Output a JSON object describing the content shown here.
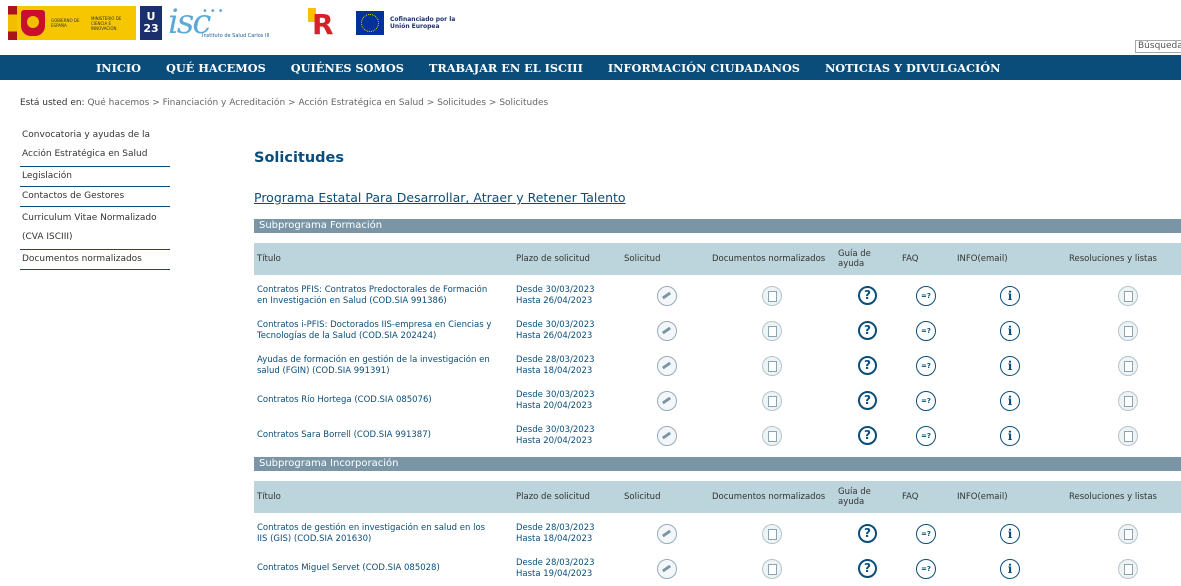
{
  "header": {
    "gov_text": [
      "GOBIERNO DE ESPAÑA",
      "MINISTERIO DE CIENCIA E INNOVACIÓN"
    ],
    "ue_text": [
      "U",
      "23"
    ],
    "isciii_logo": "isc",
    "isciii_sub": "Instituto de Salud Carlos III",
    "tr_logo": "R",
    "cofinanciado": "Cofinanciado por la Unión Europea",
    "search_placeholder": "Búsqueda..."
  },
  "nav": [
    "INICIO",
    "QUÉ HACEMOS",
    "QUIÉNES SOMOS",
    "TRABAJAR EN EL ISCIII",
    "INFORMACIÓN CIUDADANOS",
    "NOTICIAS Y DIVULGACIÓN"
  ],
  "breadcrumb": {
    "label": "Está usted en:",
    "items": [
      "Qué hacemos",
      "Financiación y Acreditación",
      "Acción Estratégica en Salud",
      "Solicitudes",
      "Solicitudes"
    ],
    "sep": ">"
  },
  "sidebar": [
    [
      "Convocatoria y ayudas de la",
      "Acción Estratégica en Salud"
    ],
    [
      "Legislación"
    ],
    [
      "Contactos de Gestores"
    ],
    [
      "Curriculum Vitae Normalizado",
      "(CVA ISCIII)"
    ],
    [
      "Documentos normalizados"
    ]
  ],
  "page_title": "Solicitudes",
  "program_title": "Programa Estatal Para Desarrollar, Atraer y Retener Talento",
  "columns": [
    "Título",
    "Plazo de solicitud",
    "Solicitud",
    "Documentos normalizados",
    "Guía de ayuda",
    "FAQ",
    "INFO(email)",
    "Resoluciones y listas"
  ],
  "icons": {
    "solicitud": "edit-icon",
    "documentos": "document-icon",
    "guia": "help-icon",
    "guia_glyph": "?",
    "faq": "faq-icon",
    "faq_glyph": "=?",
    "info": "info-icon",
    "info_glyph": "i",
    "resoluciones": "document-icon"
  },
  "subprograms": [
    {
      "name": "Subprograma Formación",
      "rows": [
        {
          "title": "Contratos PFIS: Contratos Predoctorales de Formación en Investigación en Salud (COD.SIA 991386)",
          "plazo": "Desde 30/03/2023 Hasta 26/04/2023"
        },
        {
          "title": "Contratos i-PFIS: Doctorados IIS-empresa en Ciencias y Tecnologías de la Salud (COD.SIA 202424)",
          "plazo": "Desde 30/03/2023 Hasta 26/04/2023"
        },
        {
          "title": "Ayudas de formación en gestión de la investigación en salud (FGIN) (COD.SIA 991391)",
          "plazo": "Desde 28/03/2023 Hasta 18/04/2023"
        },
        {
          "title": "Contratos Río Hortega (COD.SIA 085076)",
          "plazo": "Desde 30/03/2023 Hasta 20/04/2023"
        },
        {
          "title": "Contratos Sara Borrell (COD.SIA 991387)",
          "plazo": "Desde 30/03/2023 Hasta 20/04/2023"
        }
      ]
    },
    {
      "name": "Subprograma Incorporación",
      "rows": [
        {
          "title": "Contratos de gestión en investigación en salud en los IIS (GIS) (COD.SIA 201630)",
          "plazo": "Desde 28/03/2023 Hasta 18/04/2023"
        },
        {
          "title": "Contratos Miguel Servet (COD.SIA 085028)",
          "plazo": "Desde 28/03/2023 Hasta 19/04/2023"
        }
      ]
    }
  ],
  "colors": {
    "nav_bg": "#0a4d7a",
    "subbar_bg": "#7a96a6",
    "thead_bg": "#bcd5dd",
    "link": "#0a4d7a"
  }
}
